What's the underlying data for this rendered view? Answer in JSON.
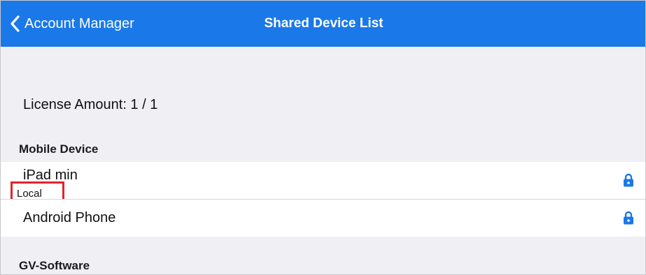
{
  "navbar": {
    "back_label": "Account Manager",
    "title": "Shared Device List",
    "color": "#1a78e8"
  },
  "license": {
    "text": "License Amount: 1 / 1"
  },
  "sections": {
    "mobile": {
      "header": "Mobile Device",
      "devices": [
        {
          "name": "iPad min",
          "sub": "Local",
          "icon": "lock-icon"
        },
        {
          "name": "Android Phone",
          "icon": "lock-icon"
        }
      ]
    },
    "software": {
      "header": "GV-Software"
    }
  },
  "colors": {
    "accent": "#1a78e8",
    "highlight_box": "#e0242c",
    "background": "#efeff4"
  }
}
